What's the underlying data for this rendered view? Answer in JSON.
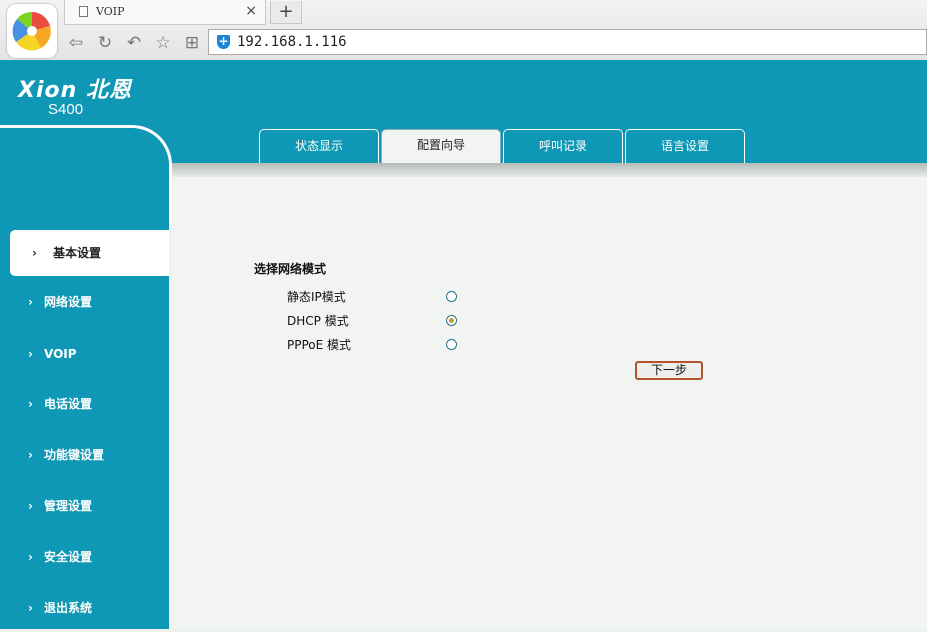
{
  "browser": {
    "tab_title": "VOIP",
    "tab_close": "×",
    "new_tab": "+",
    "address": "192.168.1.116",
    "icons": [
      "browser-logo-icon",
      "back-icon",
      "refresh-icon",
      "undo-icon",
      "star-icon",
      "grid-icon",
      "shield-icon"
    ]
  },
  "header": {
    "brand": "Xion 北恩",
    "model": "S400"
  },
  "top_tabs": [
    {
      "label": "状态显示"
    },
    {
      "label": "配置向导",
      "active": true
    },
    {
      "label": "呼叫记录"
    },
    {
      "label": "语言设置"
    }
  ],
  "sidebar": {
    "items": [
      {
        "label": "基本设置",
        "active": true
      },
      {
        "label": "网络设置"
      },
      {
        "label": "VOIP"
      },
      {
        "label": "电话设置"
      },
      {
        "label": "功能键设置"
      },
      {
        "label": "管理设置"
      },
      {
        "label": "安全设置"
      },
      {
        "label": "退出系统"
      }
    ]
  },
  "main": {
    "section_title": "选择网络模式",
    "options": [
      {
        "label": "静态IP模式",
        "checked": false
      },
      {
        "label": "DHCP 模式",
        "checked": true
      },
      {
        "label": "PPPoE 模式",
        "checked": false
      }
    ],
    "next_button": "下一步"
  },
  "colors": {
    "teal": "#0f98b5",
    "content_bg": "#f1f4f0",
    "button_border": "#b4522c"
  }
}
